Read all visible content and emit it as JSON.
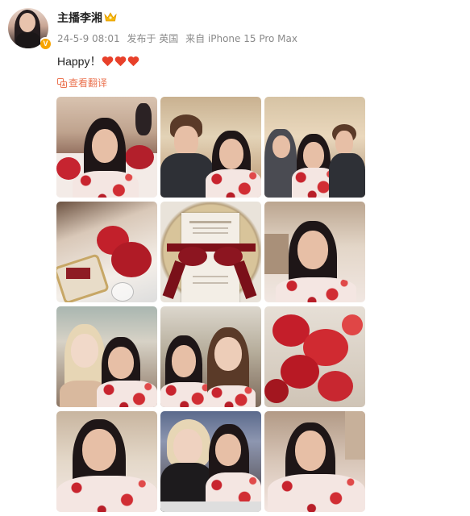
{
  "post": {
    "author": "主播李湘",
    "date": "24-5-9 08:01",
    "location": "发布于 英国",
    "device": "来自 iPhone 15 Pro Max",
    "text": "Happy！",
    "hearts": 3,
    "translate_label": "查看翻译"
  },
  "colors": {
    "accent": "#eb7350",
    "heart": "#e8402a",
    "badge": "#f7a400"
  },
  "icons": {
    "verified": "v-badge-icon",
    "crown": "crown-icon",
    "translate": "translate-icon",
    "heart": "heart-icon"
  },
  "photos": [
    {
      "id": "photo-1",
      "scene": "selfie-dining-table"
    },
    {
      "id": "photo-2",
      "scene": "two-people-restaurant"
    },
    {
      "id": "photo-3",
      "scene": "three-people-restaurant"
    },
    {
      "id": "photo-4",
      "scene": "table-setting-red-flowers"
    },
    {
      "id": "photo-5",
      "scene": "menu-card-red-ribbon"
    },
    {
      "id": "photo-6",
      "scene": "selfie-restaurant"
    },
    {
      "id": "photo-7",
      "scene": "selfie-with-blonde-friend"
    },
    {
      "id": "photo-8",
      "scene": "selfie-with-brunette-friend"
    },
    {
      "id": "photo-9",
      "scene": "red-flower-centerpiece"
    },
    {
      "id": "photo-10",
      "scene": "selfie-closeup"
    },
    {
      "id": "photo-11",
      "scene": "two-people-dinner"
    },
    {
      "id": "photo-12",
      "scene": "selfie-closeup-2"
    }
  ]
}
